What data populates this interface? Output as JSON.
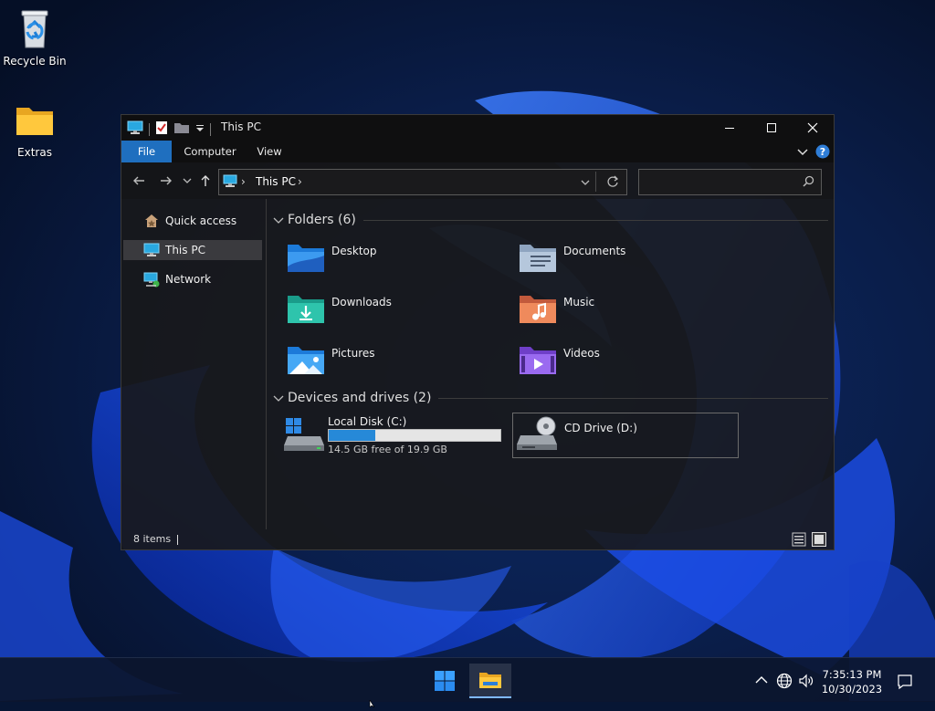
{
  "desktop": {
    "icons": [
      {
        "label": "Recycle Bin",
        "icon": "recycle-bin-icon"
      },
      {
        "label": "Extras",
        "icon": "folder-icon"
      }
    ]
  },
  "window": {
    "title": "This PC",
    "ribbon_tabs": [
      "File",
      "Computer",
      "View"
    ],
    "address": {
      "location": "This PC"
    },
    "search": {
      "placeholder": ""
    },
    "nav_pane": [
      {
        "label": "Quick access",
        "icon": "star-home-icon",
        "selected": false
      },
      {
        "label": "This PC",
        "icon": "monitor-icon",
        "selected": true
      },
      {
        "label": "Network",
        "icon": "network-icon",
        "selected": false
      }
    ],
    "groups": {
      "folders_header": "Folders (6)",
      "devices_header": "Devices and drives (2)"
    },
    "folders": [
      {
        "label": "Desktop",
        "icon": "desktop-folder-icon"
      },
      {
        "label": "Documents",
        "icon": "documents-folder-icon"
      },
      {
        "label": "Downloads",
        "icon": "downloads-folder-icon"
      },
      {
        "label": "Music",
        "icon": "music-folder-icon"
      },
      {
        "label": "Pictures",
        "icon": "pictures-folder-icon"
      },
      {
        "label": "Videos",
        "icon": "videos-folder-icon"
      }
    ],
    "drives": [
      {
        "label": "Local Disk (C:)",
        "free_text": "14.5 GB free of 19.9 GB",
        "used_fraction": 0.27,
        "icon": "local-disk-icon"
      },
      {
        "label": "CD Drive (D:)",
        "icon": "cd-drive-icon"
      }
    ],
    "status": {
      "items_text": "8 items"
    }
  },
  "taskbar": {
    "clock_time": "7:35:13 PM",
    "clock_date": "10/30/2023"
  },
  "colors": {
    "accent": "#1f6fbf",
    "drive_fill": "#2689d8",
    "selection": "#3a3a3e"
  }
}
